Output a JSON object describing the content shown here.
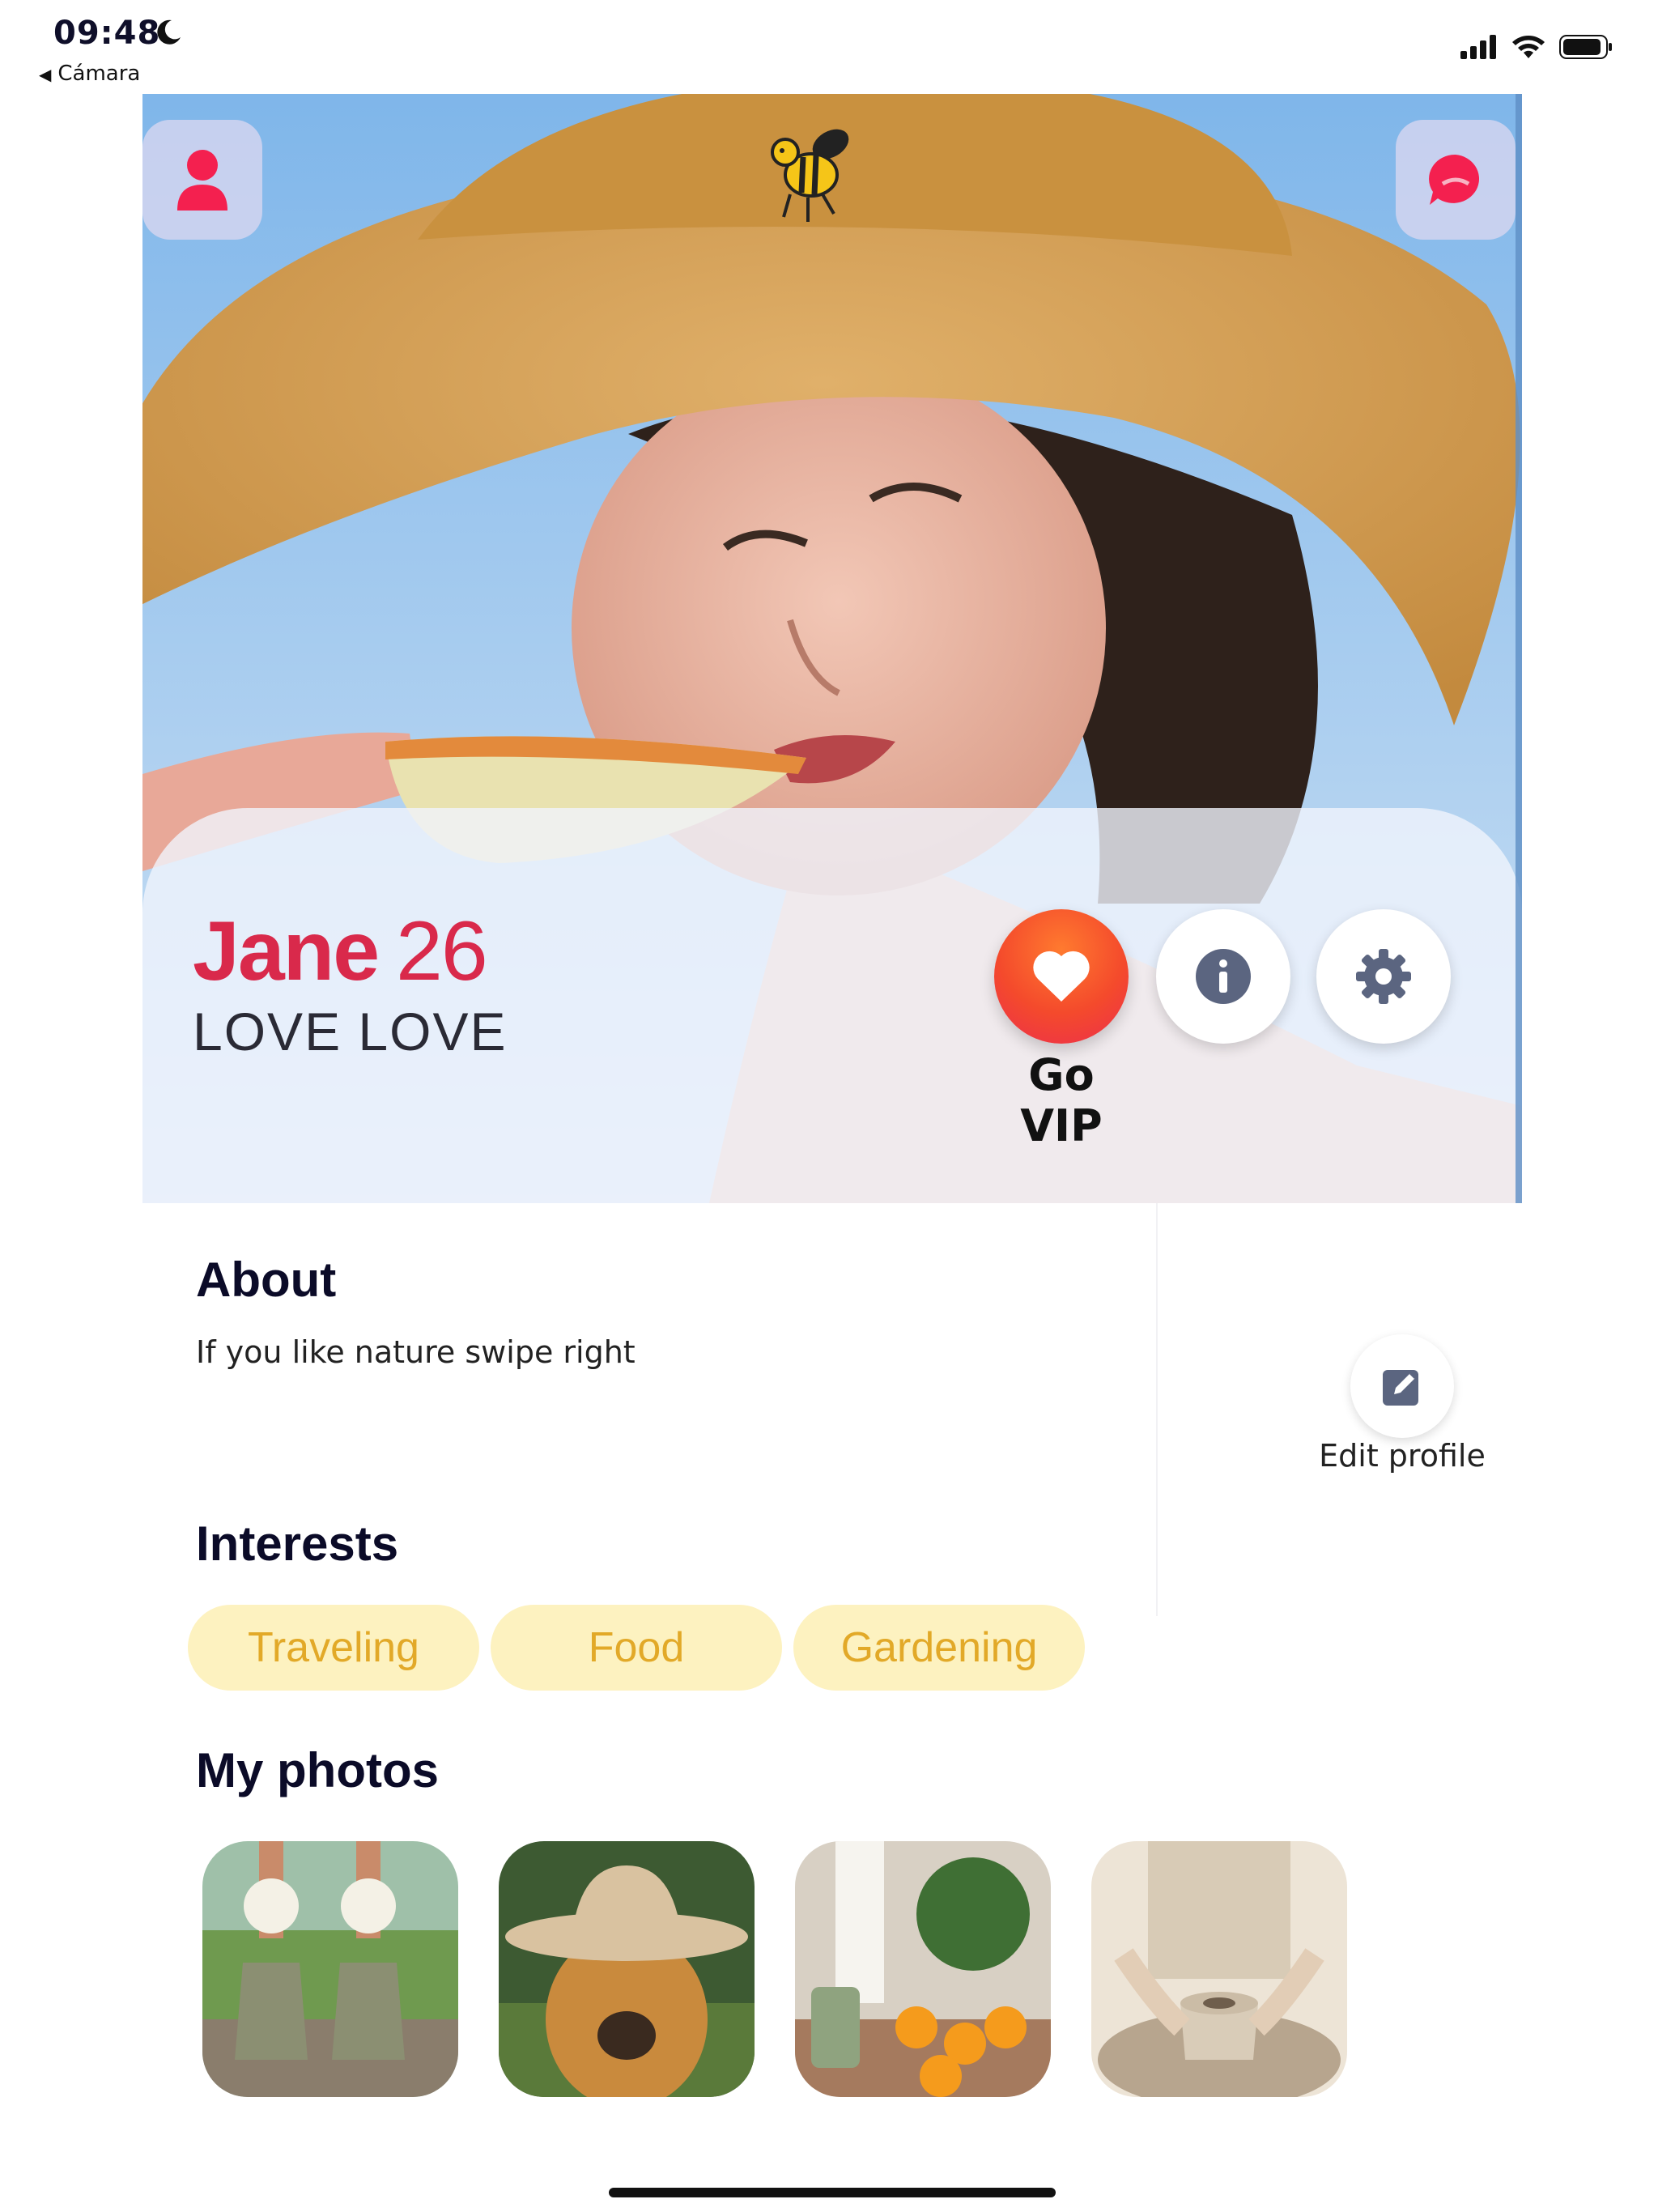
{
  "status_bar": {
    "time": "09:48",
    "back_label": "Cámara",
    "icons": [
      "moon-icon",
      "signal-icon",
      "wifi-icon",
      "battery-icon"
    ]
  },
  "header": {
    "profile_icon": "person-icon",
    "logo_icon": "bee-icon",
    "chat_icon": "chat-bubble-icon"
  },
  "profile": {
    "name": "Jane",
    "age": "26",
    "tagline": "LOVE LOVE"
  },
  "actions": {
    "vip_label": "Go VIP",
    "vip_icon": "heart-icon",
    "info_icon": "info-icon",
    "settings_icon": "gear-icon"
  },
  "about": {
    "title": "About",
    "text": "If you like nature swipe right",
    "edit_label": "Edit profile",
    "edit_icon": "edit-icon"
  },
  "interests": {
    "title": "Interests",
    "items": [
      "Traveling",
      "Food",
      "Gardening"
    ]
  },
  "photos": {
    "title": "My photos"
  },
  "colors": {
    "accent": "#d9294b",
    "chip_bg": "#fdf2c0",
    "chip_text": "#e2a928",
    "vip_gradient_start": "#ff7a2f",
    "vip_gradient_end": "#ec2e4c"
  }
}
